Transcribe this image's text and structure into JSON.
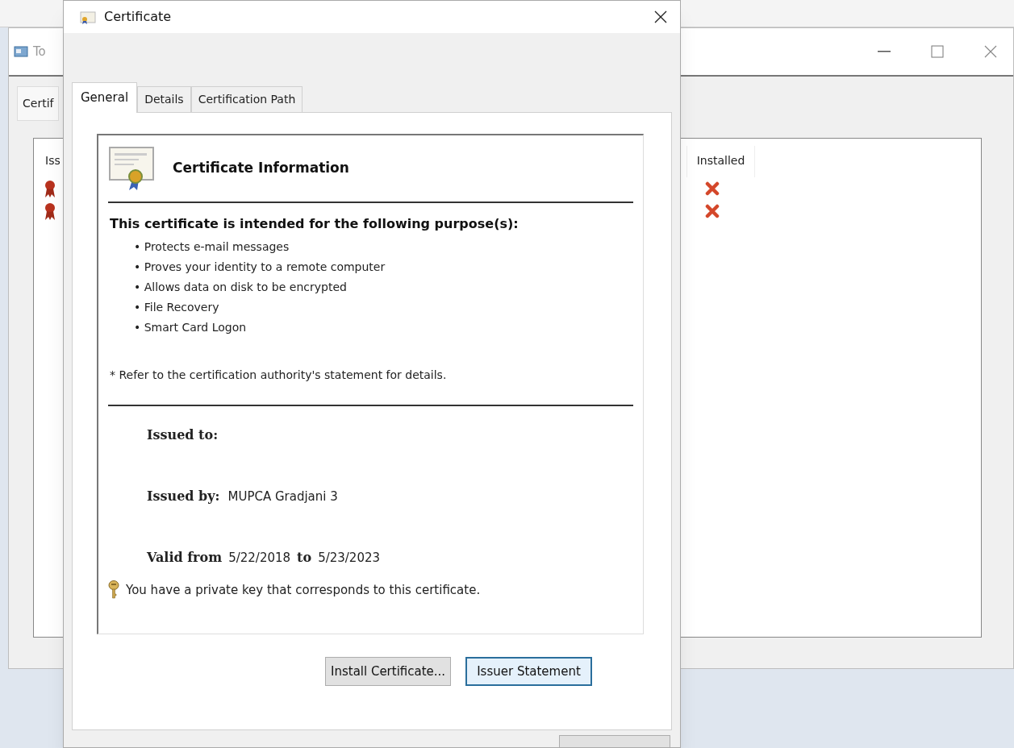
{
  "background_window": {
    "title": "To",
    "tab": "Certif",
    "columns": [
      {
        "label": "Iss"
      },
      {
        "label": "Installed"
      }
    ],
    "rows": [
      {
        "installed": false
      },
      {
        "installed": false
      }
    ]
  },
  "dialog": {
    "title": "Certificate",
    "tabs": [
      {
        "label": "General",
        "selected": true
      },
      {
        "label": "Details",
        "selected": false
      },
      {
        "label": "Certification Path",
        "selected": false
      }
    ],
    "heading": "Certificate Information",
    "purpose_title": "This certificate is intended for the following purpose(s):",
    "purposes": [
      "• Protects e-mail messages",
      "• Proves your identity to a remote computer",
      "• Allows data on disk to be encrypted",
      "• File Recovery",
      "• Smart Card Logon"
    ],
    "note": "* Refer to the certification authority's statement for details.",
    "issued_to_label": "Issued to:",
    "issued_by_label": "Issued by:",
    "issued_by": "MUPCA Gradjani 3",
    "valid_from_label": "Valid from",
    "valid_from": "5/22/2018",
    "to_label": "to",
    "valid_to": "5/23/2023",
    "private_key_note": "You have a private key that corresponds to this certificate.",
    "buttons": [
      {
        "label": "Install Certificate...",
        "focused": false
      },
      {
        "label": "Issuer Statement",
        "focused": true
      }
    ]
  }
}
